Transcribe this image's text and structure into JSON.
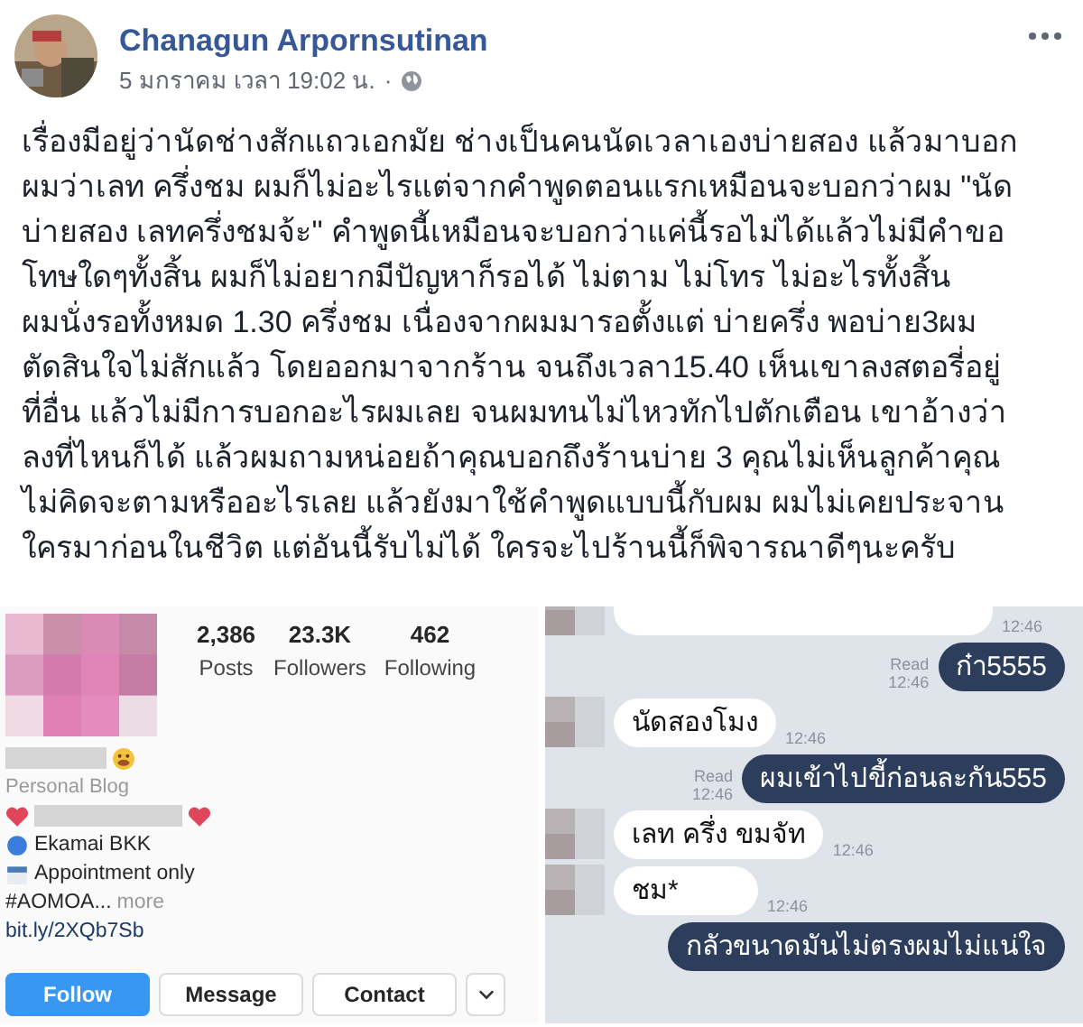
{
  "post": {
    "author": "Chanagun Arpornsutinan",
    "timestamp": "5 มกราคม เวลา 19:02 น.",
    "separator": "·",
    "text": "เรื่องมีอยู่ว่านัดช่างสักแถวเอกมัย ช่างเป็นคนนัดเวลาเองบ่ายสอง แล้วมาบอก\nผมว่าเลท ครึ่งชม ผมก็ไม่อะไรแต่จากคำพูดตอนแรกเหมือนจะบอกว่าผม \"นัด\nบ่ายสอง เลทครึ่งชมจ้ะ\" คำพูดนี้เหมือนจะบอกว่าแค่นี้รอไม่ได้แล้วไม่มีคำขอ\nโทษใดๆทั้งสิ้น ผมก็ไม่อยากมีปัญหาก็รอได้ ไม่ตาม ไม่โทร ไม่อะไรทั้งสิ้น\nผมนั่งรอทั้งหมด 1.30 ครึ่งชม เนื่องจากผมมารอตั้งแต่ บ่ายครึ่ง พอบ่าย3ผม\nตัดสินใจไม่สักแล้ว โดยออกมาจากร้าน จนถึงเวลา15.40 เห็นเขาลงสตอรี่อยู่\nที่อื่น แล้วไม่มีการบอกอะไรผมเลย จนผมทนไม่ไหวทักไปตักเตือน เขาอ้างว่า\nลงที่ไหนก็ได้ แล้วผมถามหน่อยถ้าคุณบอกถึงร้านบ่าย 3 คุณไม่เห็นลูกค้าคุณ\nไม่คิดจะตามหรืออะไรเลย แล้วยังมาใช้คำพูดแบบนี้กับผม ผมไม่เคยประจาน\nใครมาก่อนในชีวิต แต่อันนี้รับไม่ได้ ใครจะไปร้านนี้ก็พิจารณาดีๆนะครับ"
  },
  "profile": {
    "stats": [
      {
        "value": "2,386",
        "label": "Posts"
      },
      {
        "value": "23.3K",
        "label": "Followers"
      },
      {
        "value": "462",
        "label": "Following"
      }
    ],
    "category": "Personal Blog",
    "bio": [
      {
        "kind": "location",
        "text": "Ekamai BKK"
      },
      {
        "kind": "calendar",
        "text": "Appointment only"
      },
      {
        "kind": "hashtag",
        "text": "#AOMOA...",
        "more": "more"
      },
      {
        "kind": "link",
        "text": "bit.ly/2XQb7Sb"
      }
    ],
    "buttons": [
      {
        "label": "Follow",
        "primary": true
      },
      {
        "label": "Message",
        "primary": false
      },
      {
        "label": "Contact",
        "primary": false
      }
    ]
  },
  "chat": {
    "messages": [
      {
        "kind": "incoming",
        "time": "12:46"
      },
      {
        "kind": "outgoing",
        "text": "ก๋า5555",
        "read": "Read",
        "time": "12:46"
      },
      {
        "kind": "incoming",
        "text": "นัดสองโมง",
        "time": "12:46"
      },
      {
        "kind": "outgoing",
        "text": "ผมเข้าไปขี้ก่อนละกัน555",
        "read": "Read",
        "time": "12:46"
      },
      {
        "kind": "incoming",
        "text": "เลท ครึ่ง ขมจัท",
        "time": "12:46"
      },
      {
        "kind": "incoming",
        "text": "ชม*",
        "time": "12:46"
      },
      {
        "kind": "outgoing",
        "text": "กลัวขนาดมันไม่ตรงผมไม่แน่ใจ"
      }
    ]
  }
}
